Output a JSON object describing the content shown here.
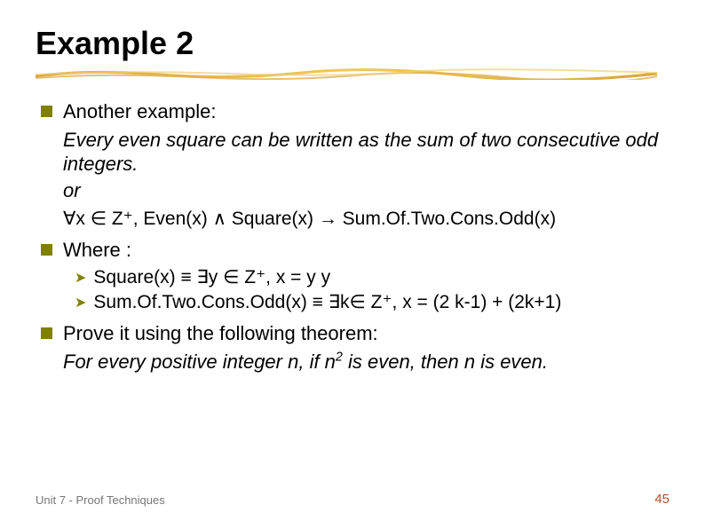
{
  "title": "Example 2",
  "bullets": {
    "b1": "Another example:",
    "b1_line1": "Every even square can be written as the sum of two consecutive odd integers.",
    "b1_line2": "or",
    "b1_formula": "∀x ∈ Z⁺, Even(x) ∧ Square(x) → Sum.Of.Two.Cons.Odd(x)",
    "b2": "Where :",
    "b2_sub1": "Square(x) ≡ ∃y ∈ Z⁺,  x = y y",
    "b2_sub2": "Sum.Of.Two.Cons.Odd(x) ≡ ∃k∈ Z⁺,  x = (2 k-1) + (2k+1)",
    "b3": "Prove it using the following theorem:",
    "b3_line1_a": "For every positive integer n, if n",
    "b3_line1_sup": "2",
    "b3_line1_b": " is even, then n is even."
  },
  "footer": {
    "left": "Unit 7 - Proof Techniques",
    "right": "45"
  }
}
